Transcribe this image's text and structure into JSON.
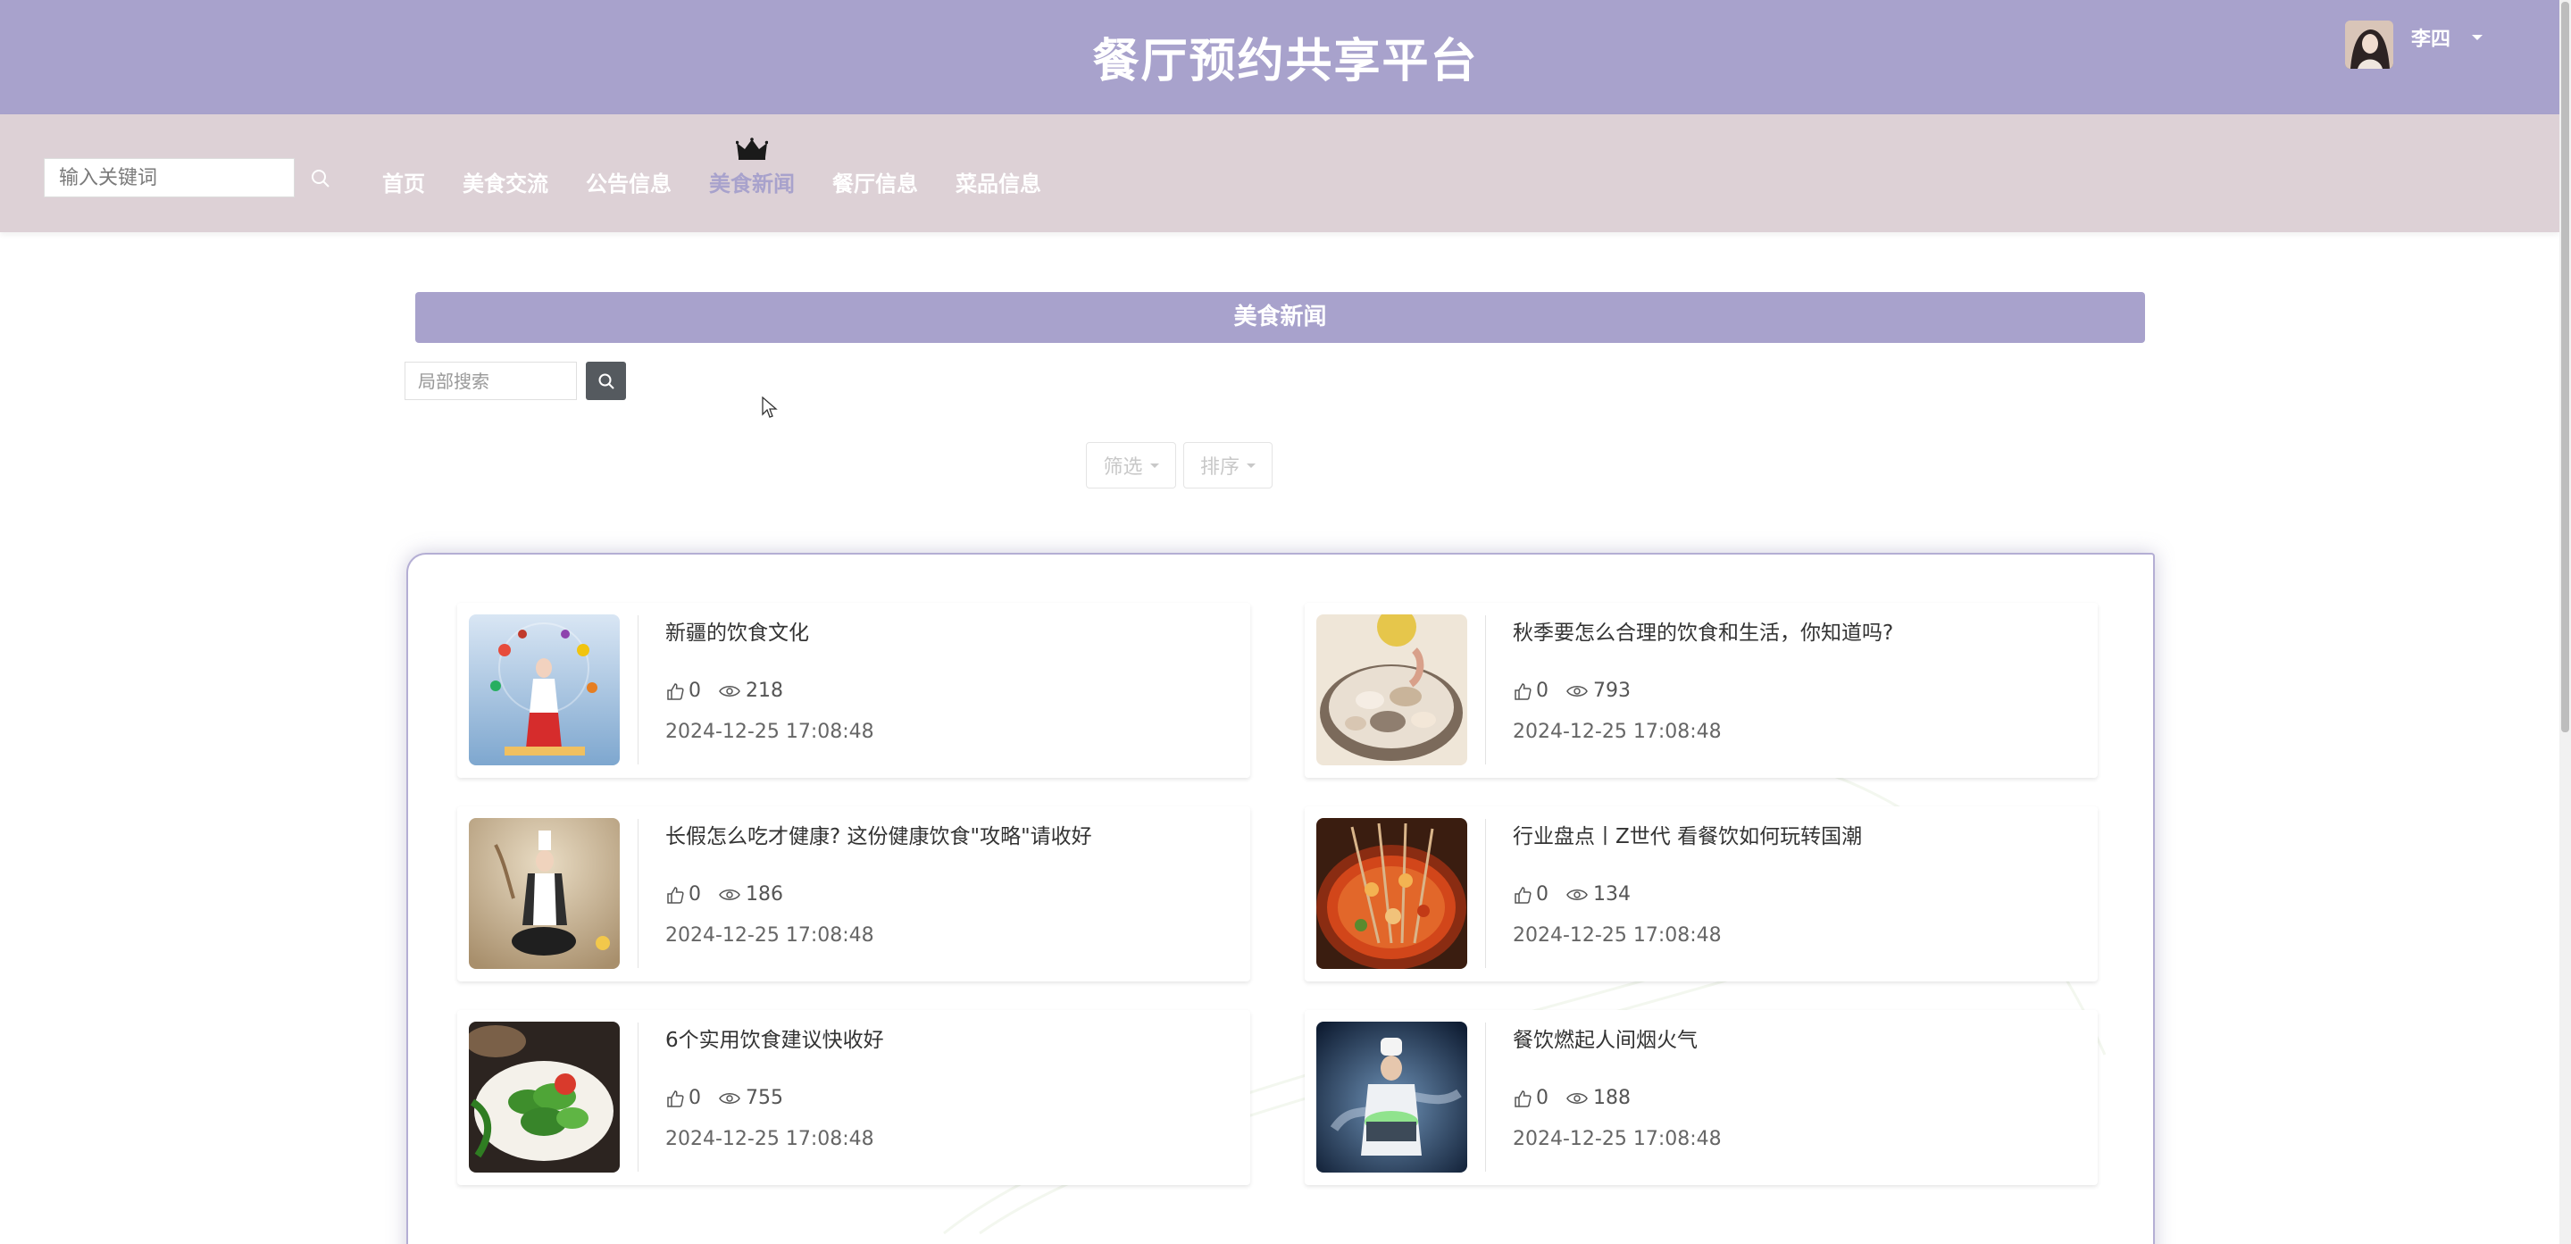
{
  "header": {
    "site_title": "餐厅预约共享平台",
    "username": "李四",
    "avatar_icon": "user-avatar",
    "dropdown_icon": "caret-down-icon"
  },
  "nav": {
    "search_placeholder": "输入关键词",
    "search_icon": "search-icon",
    "items": [
      {
        "label": "首页",
        "active": false
      },
      {
        "label": "美食交流",
        "active": false
      },
      {
        "label": "公告信息",
        "active": false
      },
      {
        "label": "美食新闻",
        "active": true
      },
      {
        "label": "餐厅信息",
        "active": false
      },
      {
        "label": "菜品信息",
        "active": false
      }
    ],
    "active_marker_icon": "crown-icon"
  },
  "main": {
    "section_title": "美食新闻",
    "local_search_placeholder": "局部搜索",
    "filter_label": "筛选",
    "sort_label": "排序",
    "news": [
      {
        "title": "新疆的饮食文化",
        "likes": "0",
        "views": "218",
        "date": "2024-12-25 17:08:48",
        "image": "chef-juggling-food"
      },
      {
        "title": "秋季要怎么合理的饮食和生活，你知道吗?",
        "likes": "0",
        "views": "793",
        "date": "2024-12-25 17:08:48",
        "image": "seafood-platter"
      },
      {
        "title": "长假怎么吃才健康? 这份健康饮食\"攻略\"请收好",
        "likes": "0",
        "views": "186",
        "date": "2024-12-25 17:08:48",
        "image": "chef-with-wok"
      },
      {
        "title": "行业盘点丨Z世代 看餐饮如何玩转国潮",
        "likes": "0",
        "views": "134",
        "date": "2024-12-25 17:08:48",
        "image": "skewers-hotpot"
      },
      {
        "title": "6个实用饮食建议快收好",
        "likes": "0",
        "views": "755",
        "date": "2024-12-25 17:08:48",
        "image": "green-vegetables"
      },
      {
        "title": "餐饮燃起人间烟火气",
        "likes": "0",
        "views": "188",
        "date": "2024-12-25 17:08:48",
        "image": "chef-with-pot"
      }
    ]
  },
  "colors": {
    "header_bg": "#a8a2cc",
    "nav_bg": "#ddd1d6",
    "accent": "#a8a2cc",
    "search_button": "#555a5f"
  }
}
